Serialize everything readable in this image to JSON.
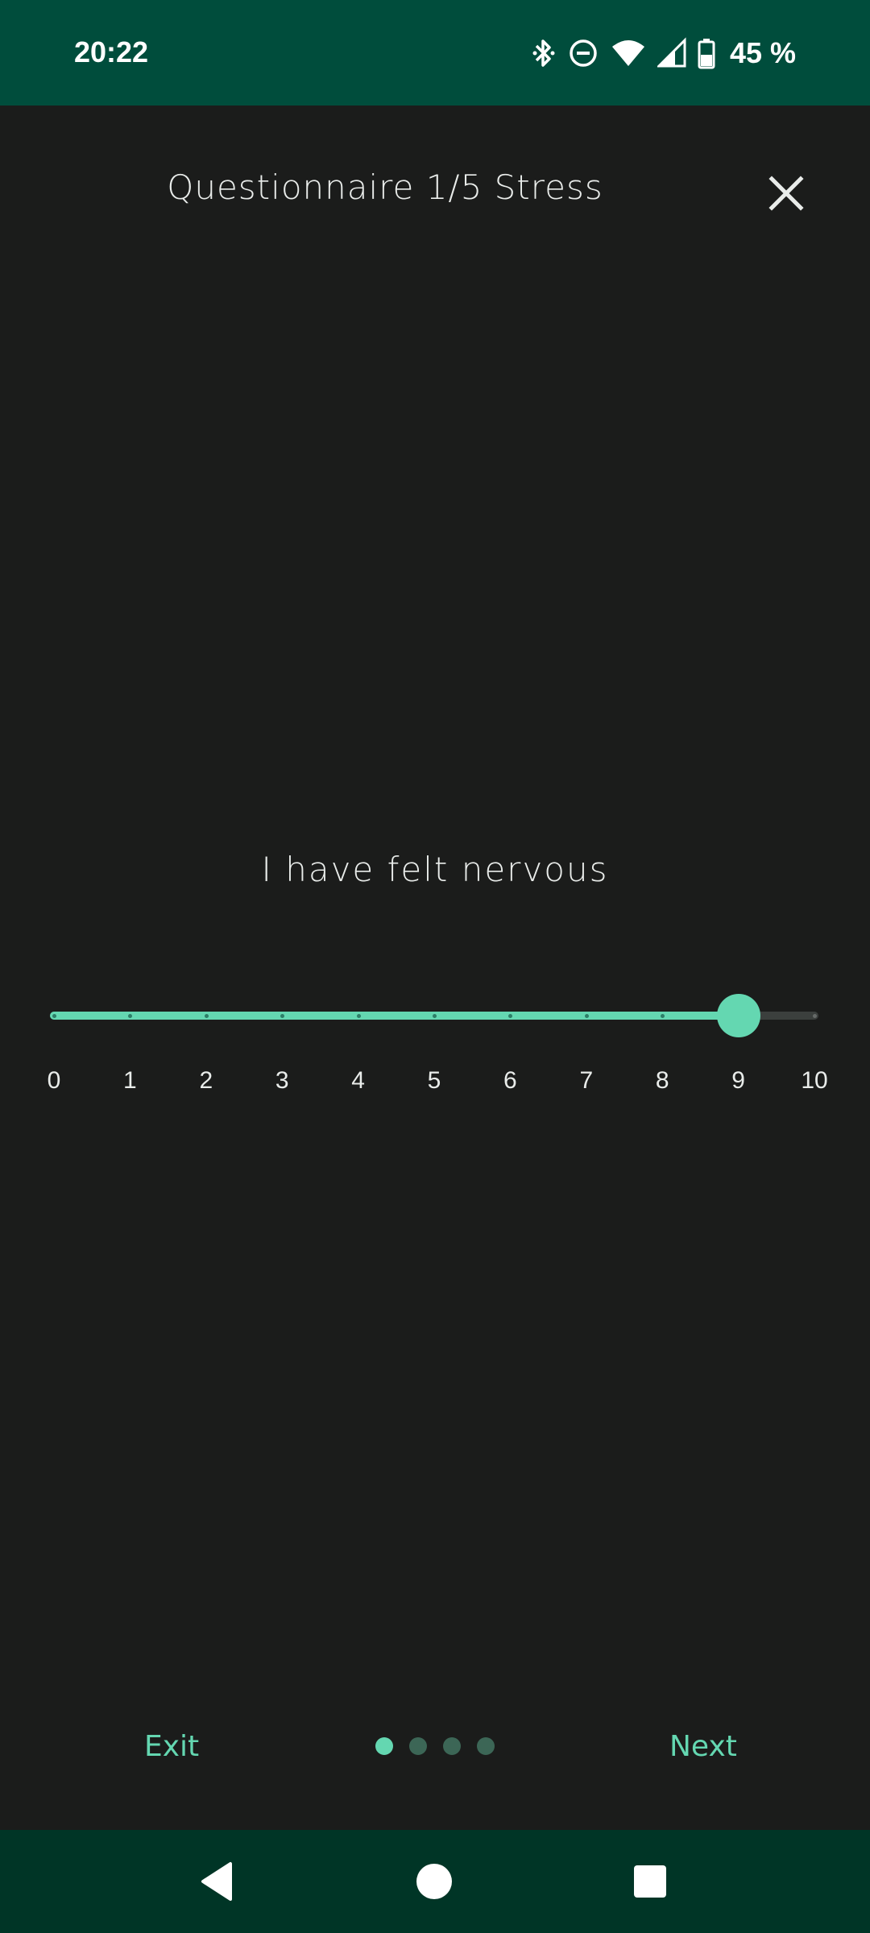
{
  "status_bar": {
    "time": "20:22",
    "battery": "45 %",
    "icons": [
      "bluetooth-icon",
      "do-not-disturb-icon",
      "wifi-icon",
      "cellular-signal-icon",
      "battery-icon"
    ]
  },
  "header": {
    "title": "Questionnaire 1/5 Stress",
    "close_icon": "close-icon"
  },
  "question": {
    "text": "I have felt nervous"
  },
  "slider": {
    "min": 0,
    "max": 10,
    "value": 9,
    "labels": [
      "0",
      "1",
      "2",
      "3",
      "4",
      "5",
      "6",
      "7",
      "8",
      "9",
      "10"
    ]
  },
  "footer": {
    "exit_label": "Exit",
    "next_label": "Next",
    "pages_total": 4,
    "current_page": 1
  },
  "nav_bar": {
    "icons": [
      "back-icon",
      "home-icon",
      "recents-icon"
    ]
  },
  "colors": {
    "accent": "#64d7b1",
    "status_bar": "#004d3c",
    "nav_bar": "#003526",
    "background": "#1b1c1b",
    "text": "#e9ecea"
  }
}
